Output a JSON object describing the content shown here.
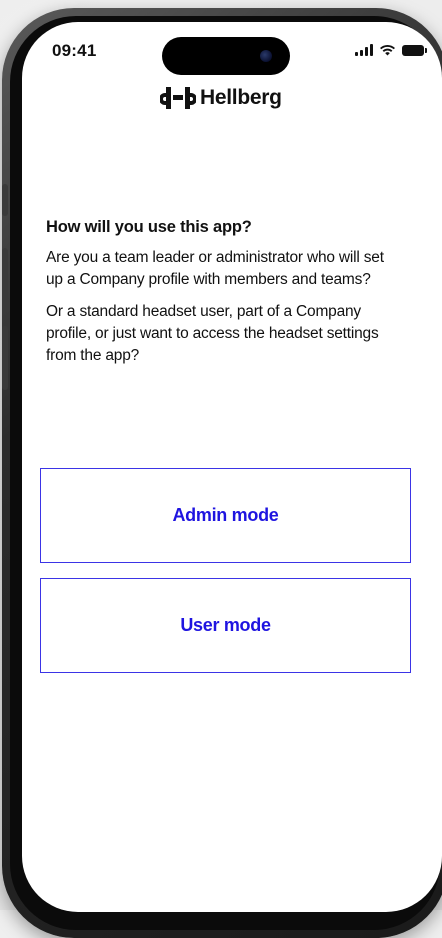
{
  "status_bar": {
    "time": "09:41"
  },
  "brand": {
    "name": "Hellberg",
    "icon": "hellberg-logo-mark"
  },
  "onboarding": {
    "question": "How will you use this app?",
    "paragraph_admin": "Are you a team leader or administrator who will set up a Company profile with members and teams?",
    "paragraph_user": "Or a standard headset user, part of a Company profile, or just want to access the headset settings from the app?"
  },
  "actions": {
    "admin_label": "Admin mode",
    "user_label": "User mode"
  },
  "colors": {
    "accent": "#1f14e0",
    "button_border": "#3b34e6",
    "text": "#111111",
    "background": "#ffffff"
  }
}
